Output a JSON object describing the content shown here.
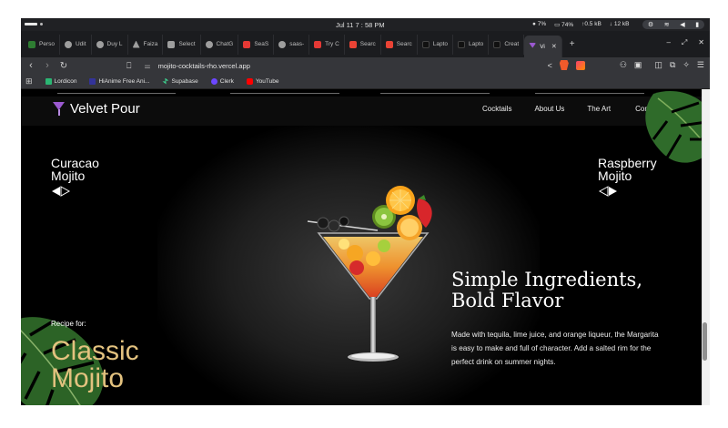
{
  "os_bar": {
    "clock": "Jul 11  7 : 58 PM",
    "stats": [
      "7%",
      "74%",
      "0.5 kB",
      "12 kB"
    ]
  },
  "tabs": [
    {
      "label": "Perso",
      "color": "#2e7d32"
    },
    {
      "label": "Udit",
      "color": "#9e9e9e"
    },
    {
      "label": "Duy L",
      "color": "#9e9e9e"
    },
    {
      "label": "Faiza",
      "color": "#9e9e9e"
    },
    {
      "label": "Select",
      "color": "#9e9e9e"
    },
    {
      "label": "ChatG",
      "color": "#9e9e9e"
    },
    {
      "label": "SeaS",
      "color": "#e53935"
    },
    {
      "label": "saas-",
      "color": "#9e9e9e"
    },
    {
      "label": "Try C",
      "color": "#e53935"
    },
    {
      "label": "Searc",
      "color": "#ea4335"
    },
    {
      "label": "Searc",
      "color": "#ea4335"
    },
    {
      "label": "Lapto",
      "color": "#1a1a1a"
    },
    {
      "label": "Lapto",
      "color": "#1a1a1a"
    },
    {
      "label": "Creat",
      "color": "#1a1a1a"
    },
    {
      "label": "Vi",
      "color": "#9b59d0",
      "active": true
    }
  ],
  "tab_new": "+",
  "window_controls": [
    "–",
    "⤢",
    "✕"
  ],
  "address": {
    "url": "mojito-cocktails-rho.vercel.app"
  },
  "bookmarks": [
    {
      "label": "Lordicon",
      "color": "#2bb673"
    },
    {
      "label": "HiAnime Free Ani...",
      "color": "#333399"
    },
    {
      "label": "Supabase",
      "color": "#3ecf8e"
    },
    {
      "label": "Clerk",
      "color": "#6c47ff"
    },
    {
      "label": "YouTube",
      "color": "#ff0000"
    }
  ],
  "site": {
    "brand": "Velvet Pour",
    "nav": [
      "Cocktails",
      "About Us",
      "The Art",
      "Contact"
    ],
    "prev_cocktail": [
      "Curacao",
      "Mojito"
    ],
    "next_cocktail": [
      "Raspberry",
      "Mojito"
    ],
    "headline": [
      "Simple Ingredients,",
      "Bold Flavor"
    ],
    "description": "Made with tequila, lime juice, and orange liqueur, the Margarita is easy to make and full of character. Add a salted rim for the perfect drink on summer nights.",
    "recipe_label": "Recipe for:",
    "recipe_title": [
      "Classic",
      "Mojito"
    ],
    "accent_color": "#e3c27f"
  }
}
